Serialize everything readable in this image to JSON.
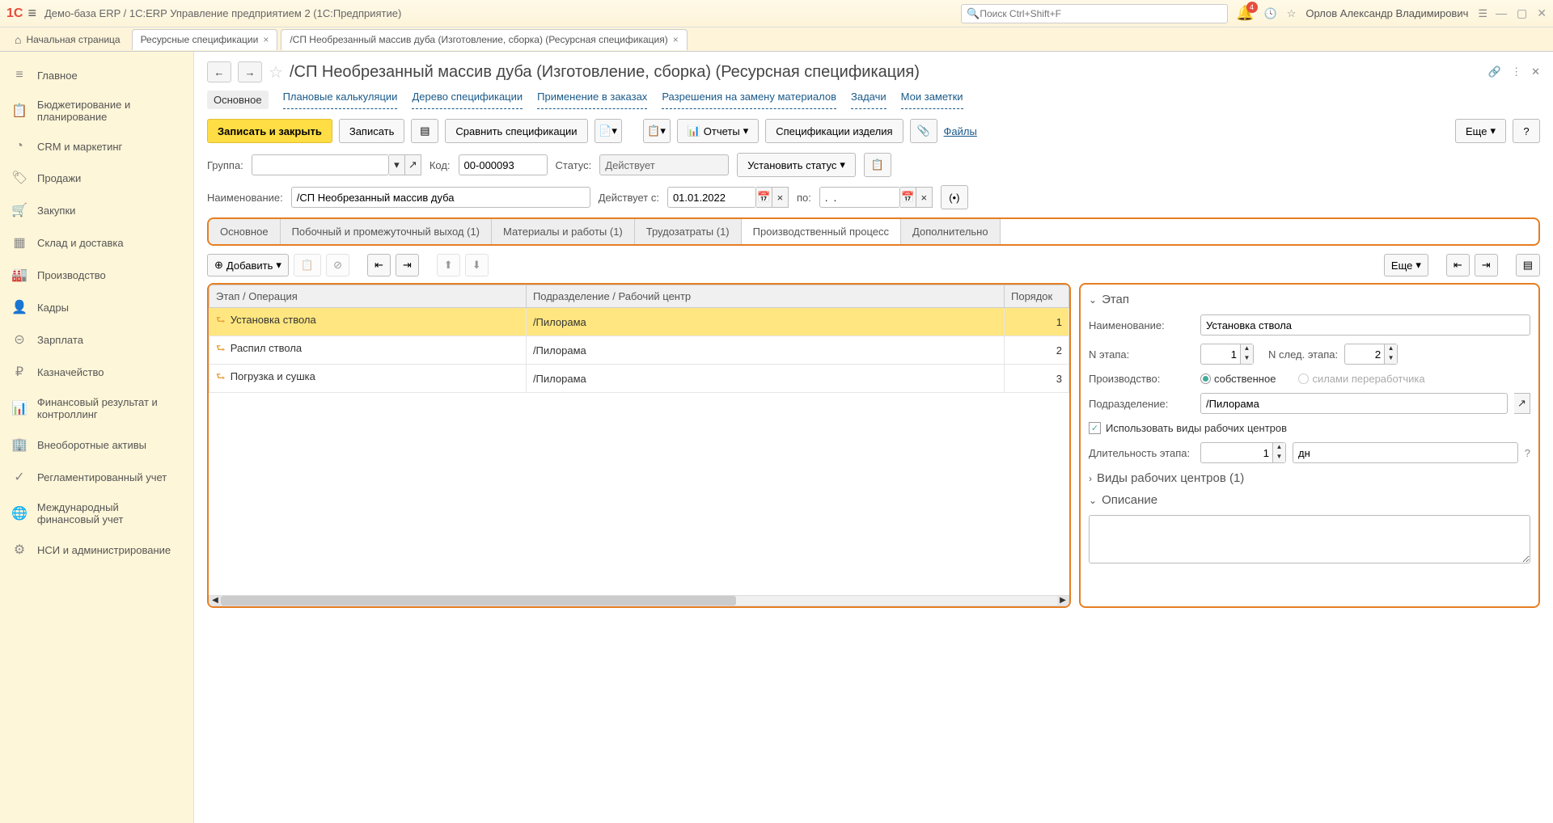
{
  "topbar": {
    "title": "Демо-база ERP / 1C:ERP Управление предприятием 2  (1С:Предприятие)",
    "search_placeholder": "Поиск Ctrl+Shift+F",
    "notif_count": "4",
    "username": "Орлов Александр Владимирович"
  },
  "tabs": {
    "home": "Начальная страница",
    "t1": "Ресурсные спецификации",
    "t2": "/СП Необрезанный массив дуба (Изготовление, сборка) (Ресурсная спецификация)"
  },
  "sidebar": [
    {
      "icon": "≡",
      "label": "Главное"
    },
    {
      "icon": "📋",
      "label": "Бюджетирование и планирование"
    },
    {
      "icon": "◔",
      "label": "CRM и маркетинг"
    },
    {
      "icon": "🏷",
      "label": "Продажи"
    },
    {
      "icon": "🛒",
      "label": "Закупки"
    },
    {
      "icon": "▦",
      "label": "Склад и доставка"
    },
    {
      "icon": "🏭",
      "label": "Производство"
    },
    {
      "icon": "👤",
      "label": "Кадры"
    },
    {
      "icon": "⊝",
      "label": "Зарплата"
    },
    {
      "icon": "₽",
      "label": "Казначейство"
    },
    {
      "icon": "📊",
      "label": "Финансовый результат и контроллинг"
    },
    {
      "icon": "🏢",
      "label": "Внеоборотные активы"
    },
    {
      "icon": "✓",
      "label": "Регламентированный учет"
    },
    {
      "icon": "🌐",
      "label": "Международный финансовый учет"
    },
    {
      "icon": "⚙",
      "label": "НСИ и администрирование"
    }
  ],
  "page": {
    "title": "/СП Необрезанный массив дуба (Изготовление, сборка) (Ресурсная спецификация)"
  },
  "navlinks": {
    "main": "Основное",
    "l1": "Плановые калькуляции",
    "l2": "Дерево спецификации",
    "l3": "Применение в заказах",
    "l4": "Разрешения на замену материалов",
    "l5": "Задачи",
    "l6": "Мои заметки"
  },
  "toolbar": {
    "save_close": "Записать и закрыть",
    "save": "Записать",
    "compare": "Сравнить спецификации",
    "reports": "Отчеты",
    "spec_prod": "Спецификации изделия",
    "files": "Файлы",
    "more": "Еще"
  },
  "form": {
    "group_label": "Группа:",
    "group_value": "",
    "code_label": "Код:",
    "code_value": "00-000093",
    "status_label": "Статус:",
    "status_value": "Действует",
    "set_status": "Установить статус",
    "name_label": "Наименование:",
    "name_value": "/СП Необрезанный массив дуба",
    "valid_from_label": "Действует с:",
    "valid_from_value": "01.01.2022",
    "to_label": "по:",
    "to_value": ".  ."
  },
  "inner_tabs": {
    "t1": "Основное",
    "t2": "Побочный и промежуточный выход (1)",
    "t3": "Материалы и работы (1)",
    "t4": "Трудозатраты (1)",
    "t5": "Производственный процесс",
    "t6": "Дополнительно"
  },
  "subtoolbar": {
    "add": "Добавить",
    "more": "Еще"
  },
  "table": {
    "col1": "Этап / Операция",
    "col2": "Подразделение / Рабочий центр",
    "col3": "Порядок",
    "rows": [
      {
        "name": "Установка ствола",
        "dept": "/Пилорама",
        "order": "1"
      },
      {
        "name": "Распил ствола",
        "dept": "/Пилорама",
        "order": "2"
      },
      {
        "name": "Погрузка и сушка",
        "dept": "/Пилорама",
        "order": "3"
      }
    ]
  },
  "stage_panel": {
    "title": "Этап",
    "name_label": "Наименование:",
    "name_value": "Установка ствола",
    "num_label": "N этапа:",
    "num_value": "1",
    "next_label": "N след. этапа:",
    "next_value": "2",
    "prod_label": "Производство:",
    "own": "собственное",
    "external": "силами переработчика",
    "dept_label": "Подразделение:",
    "dept_value": "/Пилорама",
    "use_wc": "Использовать виды рабочих центров",
    "duration_label": "Длительность этапа:",
    "duration_value": "1",
    "duration_unit": "дн",
    "wc_types": "Виды рабочих центров (1)",
    "description": "Описание"
  }
}
